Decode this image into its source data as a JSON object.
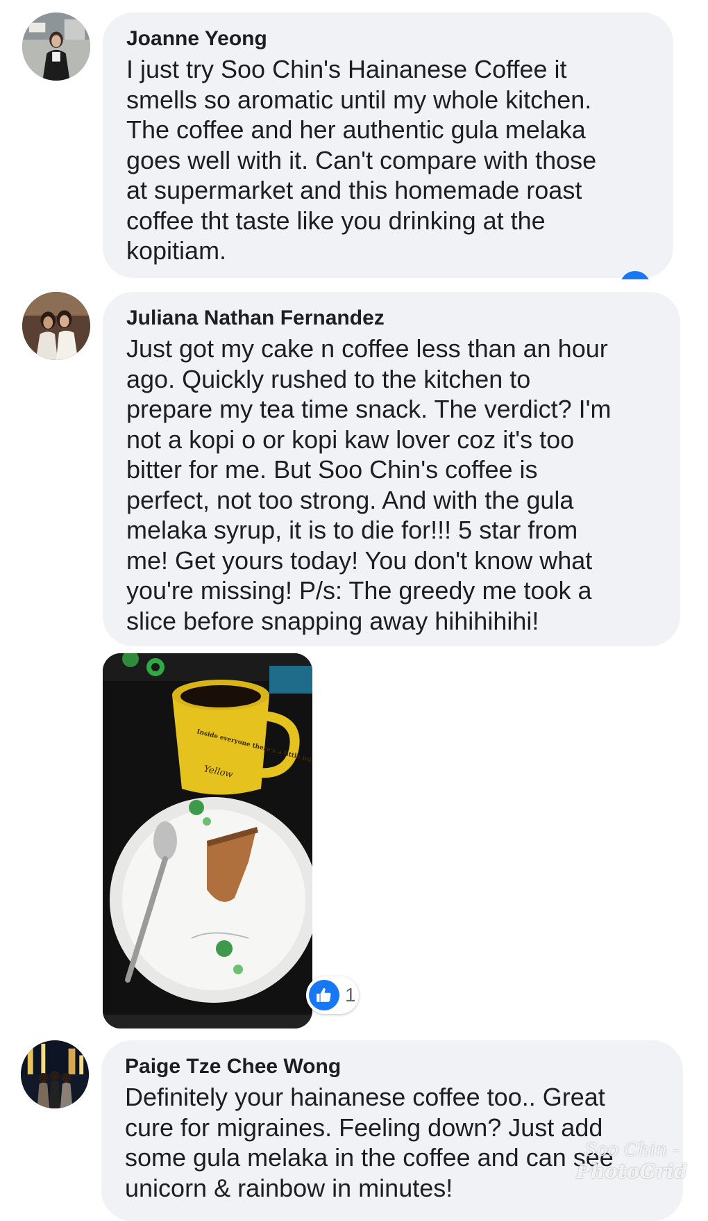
{
  "comments": [
    {
      "author": "Joanne Yeong",
      "text": "I just try Soo Chin's Hainanese Coffee it\nsmells so aromatic until my whole kitchen.\nThe coffee and her authentic gula melaka\ngoes well with it. Can't compare with those\nat supermarket and this homemade roast\ncoffee tht taste like you drinking at the\nkopitiam."
    },
    {
      "author": "Juliana Nathan Fernandez",
      "text": "Just got my cake n coffee less than an hour\nago. Quickly rushed to the kitchen to\nprepare my tea time snack. The verdict? I'm\nnot a kopi o or kopi kaw lover coz it's too\nbitter for me. But Soo Chin's coffee is\nperfect, not too strong. And with the gula\nmelaka syrup, it is to die for!!! 5 star from\nme! Get yours today! You don't know what\nyou're missing! P/s: The greedy me took a\nslice before snapping away hihihihihi!",
      "reaction_count": "1"
    },
    {
      "author": "Paige Tze Chee Wong",
      "text": "Definitely your hainanese coffee too.. Great\ncure for migraines. Feeling down? Just add\nsome gula melaka in the coffee and can see\nunicorn & rainbow in minutes!"
    }
  ],
  "photo": {
    "mug_text": "Inside everyone there's a little nut.",
    "mug_brand": "Yellow"
  },
  "watermark": {
    "line1": "Soo Chin -",
    "line2": "PhotoGrid"
  },
  "colors": {
    "bubble": "#f0f2f5",
    "like_blue": "#1877f2",
    "name_text": "#1c1e21"
  },
  "icons": [
    "like-thumb-icon"
  ]
}
